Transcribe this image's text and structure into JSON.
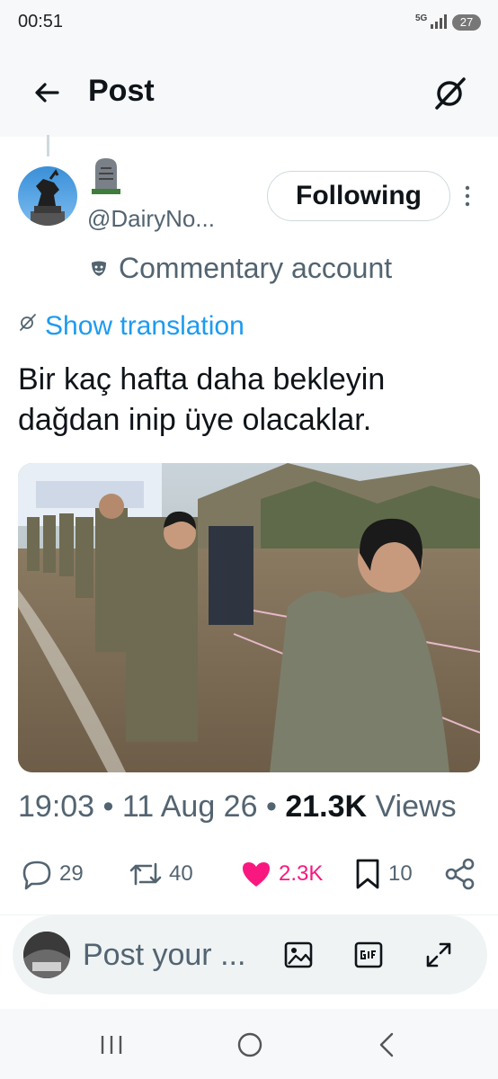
{
  "status_bar": {
    "time": "00:51",
    "network": "5G",
    "battery": "27"
  },
  "header": {
    "title": "Post",
    "back_icon": "arrow-left-icon",
    "grok_icon": "grok-icon"
  },
  "author": {
    "display_name_icon": "tombstone-emoji",
    "handle": "@DairyNo...",
    "follow_label": "Following",
    "label_icon": "theater-mask-icon",
    "label_text": "Commentary account"
  },
  "post": {
    "translate_label": "Show translation",
    "text": "Bir kaç hafta daha bekleyin dağdan inip üye olacaklar.",
    "timestamp": "19:03 • 11 Aug 26 • ",
    "views_count": "21.3K",
    "views_label": " Views"
  },
  "actions": {
    "replies": "29",
    "reposts": "40",
    "likes": "2.3K",
    "bookmarks": "10"
  },
  "reply": {
    "placeholder": "Post your ..."
  },
  "colors": {
    "accent": "#1d9bf0",
    "like": "#f91880",
    "text_secondary": "#536471"
  }
}
